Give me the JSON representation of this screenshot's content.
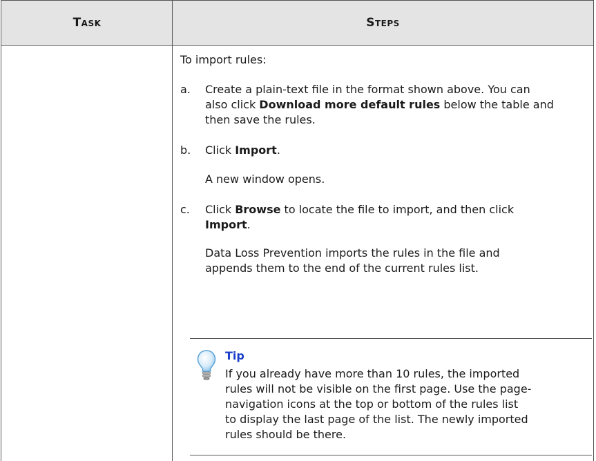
{
  "header": {
    "task": "Task",
    "steps": "Steps"
  },
  "intro": "To import rules:",
  "steps": {
    "a_letter": "a.",
    "a_line1": "Create a plain-text file in the format shown above. You can",
    "a_line2_pre": "also click ",
    "a_line2_bold": "Download more default rules",
    "a_line2_post": " below the table and",
    "a_line3": "then save the rules.",
    "b_letter": "b.",
    "b_pre": "Click ",
    "b_bold": "Import",
    "b_post": ".",
    "b_note": "A new window opens.",
    "c_letter": "c.",
    "c_pre": "Click ",
    "c_bold1": "Browse",
    "c_mid": " to locate the file to import, and then click",
    "c_bold2": "Import",
    "c_post": ".",
    "c_note1": "Data Loss Prevention imports the rules in the file and",
    "c_note2": "appends them to the end of the current rules list."
  },
  "tip": {
    "icon": "lightbulb-icon",
    "title": "Tip",
    "line1": "If you already have more than 10 rules, the imported",
    "line2": "rules will not be visible on the first page. Use the page-",
    "line3": "navigation icons at the top or bottom of the rules list",
    "line4": "to display the last page of the list. The newly imported",
    "line5": "rules should be there."
  },
  "colors": {
    "tip_title": "#1a3fc8",
    "header_bg": "#e4e4e4"
  }
}
